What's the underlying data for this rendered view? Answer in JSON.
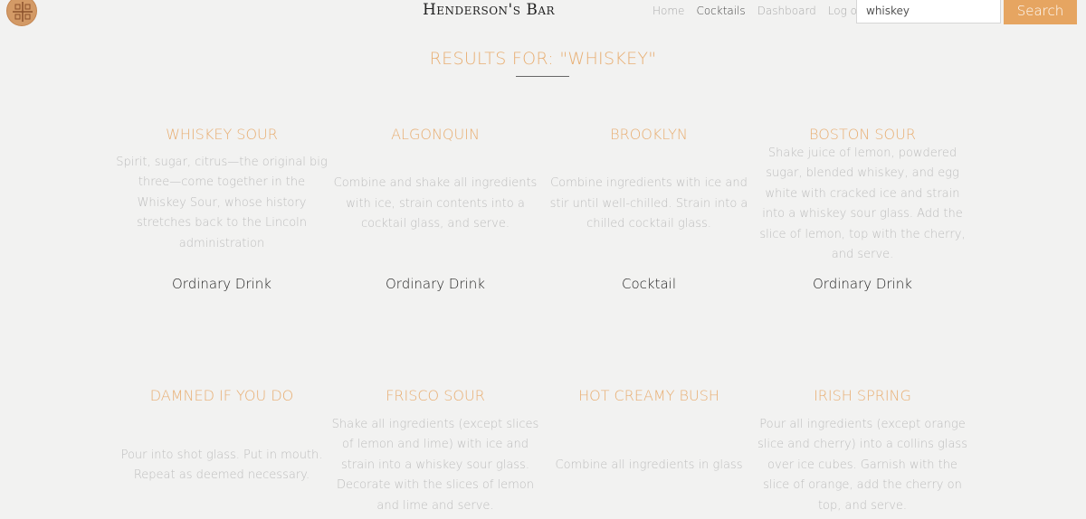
{
  "header": {
    "brand": "Henderson's Bar",
    "nav": [
      {
        "label": "Home",
        "active": false
      },
      {
        "label": "Cocktails",
        "active": true
      },
      {
        "label": "Dashboard",
        "active": false
      },
      {
        "label": "Log out",
        "active": false
      }
    ],
    "search_value": "whiskey",
    "search_button": "Search"
  },
  "results_title": "Results for: \"whiskey\"",
  "cocktails": [
    {
      "name": "Whiskey Sour",
      "description": "Spirit, sugar, citrus—the original big three—come together in the Whiskey Sour, whose history stretches back to the Lincoln administration",
      "category": "Ordinary Drink"
    },
    {
      "name": "Algonquin",
      "description": "Combine and shake all ingredients with ice, strain contents into a cocktail glass, and serve.",
      "category": "Ordinary Drink"
    },
    {
      "name": "Brooklyn",
      "description": "Combine ingredients with ice and stir until well-chilled. Strain into a chilled cocktail glass.",
      "category": "Cocktail"
    },
    {
      "name": "Boston Sour",
      "description": "Shake juice of lemon, powdered sugar, blended whiskey, and egg white with cracked ice and strain into a whiskey sour glass. Add the slice of lemon, top with the cherry, and serve.",
      "category": "Ordinary Drink"
    },
    {
      "name": "Damned if you do",
      "description": "Pour into shot glass. Put in mouth. Repeat as deemed necessary.",
      "category": ""
    },
    {
      "name": "Frisco Sour",
      "description": "Shake all ingredients (except slices of lemon and lime) with ice and strain into a whiskey sour glass. Decorate with the slices of lemon and lime and serve.",
      "category": ""
    },
    {
      "name": "Hot Creamy Bush",
      "description": "Combine all ingredients in glass",
      "category": ""
    },
    {
      "name": "Irish Spring",
      "description": "Pour all ingredients (except orange slice and cherry) into a collins glass over ice cubes. Garnish with the slice of orange, add the cherry on top, and serve.",
      "category": ""
    }
  ]
}
